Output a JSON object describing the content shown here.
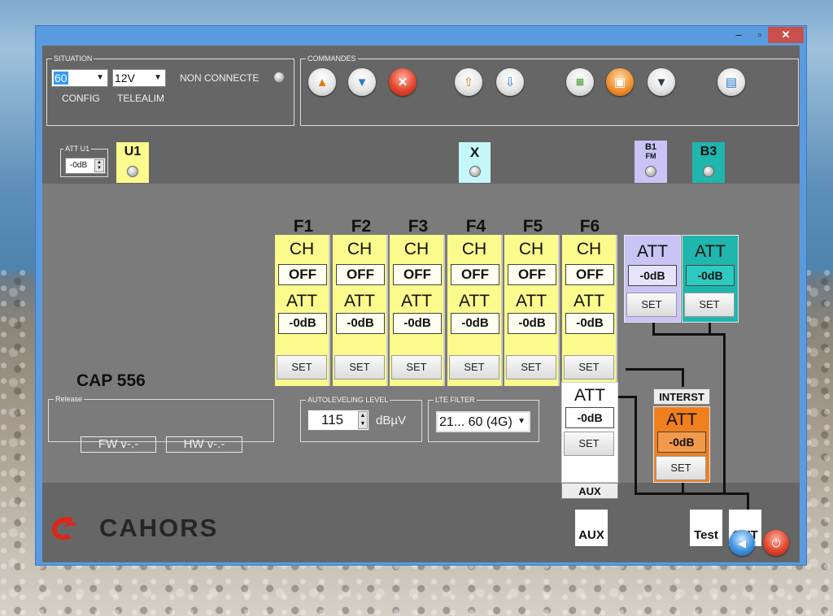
{
  "titlebar": {
    "minimize": "–",
    "maximize": "▫",
    "close": "✕"
  },
  "situation": {
    "legend": "SITUATION",
    "config_value": "60",
    "telealim_value": "12V",
    "status": "NON CONNECTE",
    "config_label": "CONFIG",
    "telealim_label": "TELEALIM"
  },
  "commandes": {
    "legend": "COMMANDES"
  },
  "att_u1": {
    "legend": "ATT U1",
    "value": "-0dB"
  },
  "tags": {
    "u1": "U1",
    "x": "X",
    "b1_line1": "B1",
    "b1_line2": "FM",
    "b3": "B3"
  },
  "filters": [
    {
      "name": "F1",
      "ch_title": "CH",
      "ch_value": "OFF",
      "att_title": "ATT",
      "att_value": "-0dB",
      "set": "SET"
    },
    {
      "name": "F2",
      "ch_title": "CH",
      "ch_value": "OFF",
      "att_title": "ATT",
      "att_value": "-0dB",
      "set": "SET"
    },
    {
      "name": "F3",
      "ch_title": "CH",
      "ch_value": "OFF",
      "att_title": "ATT",
      "att_value": "-0dB",
      "set": "SET"
    },
    {
      "name": "F4",
      "ch_title": "CH",
      "ch_value": "OFF",
      "att_title": "ATT",
      "att_value": "-0dB",
      "set": "SET"
    },
    {
      "name": "F5",
      "ch_title": "CH",
      "ch_value": "OFF",
      "att_title": "ATT",
      "att_value": "-0dB",
      "set": "SET"
    },
    {
      "name": "F6",
      "ch_title": "CH",
      "ch_value": "OFF",
      "att_title": "ATT",
      "att_value": "-0dB",
      "set": "SET"
    }
  ],
  "b1_panel": {
    "title": "ATT",
    "value": "-0dB",
    "set": "SET"
  },
  "b3_panel": {
    "title": "ATT",
    "value": "-0dB",
    "set": "SET"
  },
  "aux_panel": {
    "title": "ATT",
    "value": "-0dB",
    "set": "SET",
    "label": "AUX"
  },
  "interst_panel": {
    "label": "INTERST",
    "title": "ATT",
    "value": "-0dB",
    "set": "SET"
  },
  "device": {
    "name": "CAP 556"
  },
  "release": {
    "legend": "Release",
    "fw": "FW v-.-",
    "hw": "HW v-.-"
  },
  "autolevel": {
    "legend": "AUTOLEVELING LEVEL",
    "value": "115",
    "unit": "dBµV"
  },
  "lte": {
    "legend": "LTE FILTER",
    "value": "21... 60 (4G)"
  },
  "outputs": {
    "aux": "AUX",
    "test": "Test",
    "out": "OUT"
  },
  "brand": {
    "name": "CAHORS"
  },
  "colors": {
    "filter_yellow": "#fbfa8c",
    "b1_lavender": "#c9c4f5",
    "b3_teal": "#1eb6ad",
    "x_cyan": "#c6f7f8",
    "interst_orange": "#f07f1e",
    "brand_red": "#d8281c"
  }
}
